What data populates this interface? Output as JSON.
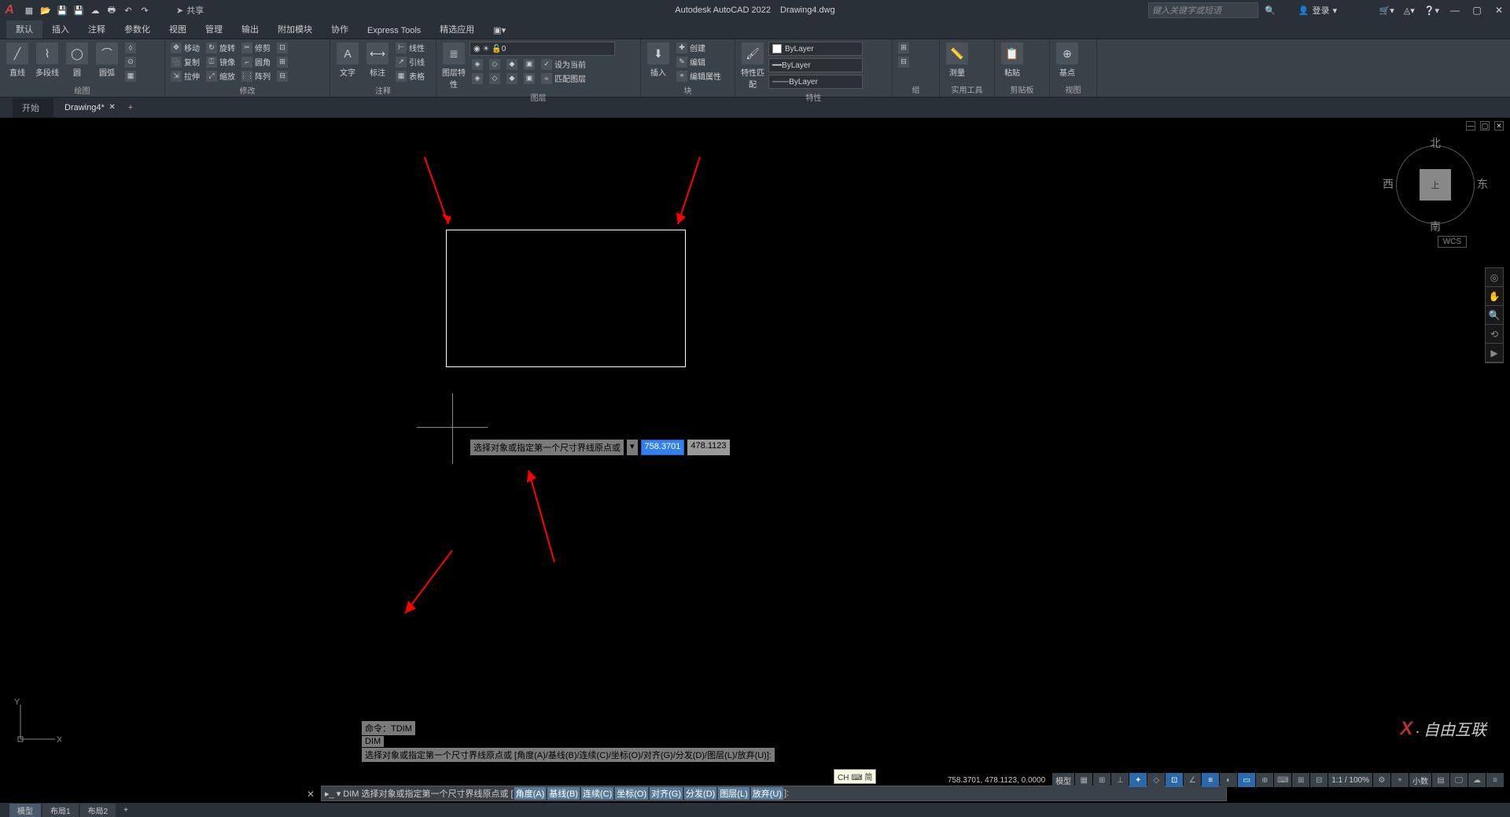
{
  "title": {
    "app": "Autodesk AutoCAD 2022",
    "file": "Drawing4.dwg"
  },
  "share": "共享",
  "search_placeholder": "键入关键字或短语",
  "login": "登录",
  "menutabs": [
    "默认",
    "插入",
    "注释",
    "参数化",
    "视图",
    "管理",
    "输出",
    "附加模块",
    "协作",
    "Express Tools",
    "精选应用"
  ],
  "ribbon": {
    "draw": {
      "title": "绘图",
      "line": "直线",
      "polyline": "多段线",
      "circle": "圆",
      "arc": "圆弧"
    },
    "modify": {
      "title": "修改",
      "move": "移动",
      "copy": "复制",
      "stretch": "拉伸",
      "rotate": "旋转",
      "mirror": "镜像",
      "scale": "缩放",
      "trim": "修剪",
      "fillet": "圆角",
      "array": "阵列"
    },
    "annot": {
      "title": "注释",
      "text": "文字",
      "dim": "标注",
      "linear": "线性",
      "leader": "引线",
      "table": "表格"
    },
    "layers": {
      "title": "图层",
      "props": "图层特性",
      "current": "设为当前",
      "match": "匹配图层",
      "value": "0"
    },
    "block": {
      "title": "块",
      "insert": "插入",
      "create": "创建",
      "edit": "编辑",
      "attr": "编辑属性"
    },
    "props": {
      "title": "特性",
      "match": "特性匹配",
      "bylayer": "ByLayer"
    },
    "group": {
      "title": "组"
    },
    "util": {
      "title": "实用工具",
      "measure": "测量"
    },
    "clip": {
      "title": "剪贴板",
      "paste": "粘贴"
    },
    "view": {
      "title": "视图",
      "base": "基点"
    }
  },
  "filetabs": {
    "start": "开始",
    "active": "Drawing4*"
  },
  "viewcube": {
    "n": "北",
    "s": "南",
    "e": "东",
    "w": "西",
    "top": "上",
    "wcs": "WCS"
  },
  "tooltip": {
    "label": "选择对象或指定第一个尺寸界线原点或",
    "x": "758.3701",
    "y": "478.1123"
  },
  "cmd_history": {
    "l1": "命令：TDIM",
    "l2": "DIM",
    "l3": "选择对象或指定第一个尺寸界线原点或 [角度(A)/基线(B)/连续(C)/坐标(O)/对齐(G)/分发(D)/图层(L)/放弃(U)]:"
  },
  "cmdline": {
    "prefix": "DIM 选择对象或指定第一个尺寸界线原点或 [",
    "opts": [
      "角度(A)",
      "基线(B)",
      "连续(C)",
      "坐标(O)",
      "对齐(G)",
      "分发(D)",
      "图层(L)",
      "放弃(U)"
    ],
    "suffix": "]:"
  },
  "layout_tabs": {
    "model": "模型",
    "l1": "布局1",
    "l2": "布局2"
  },
  "statusbar": {
    "coords": "758.3701, 478.1123, 0.0000",
    "model": "模型",
    "scale": "1:1 / 100%",
    "decimal": "小数"
  },
  "ime": "CH ⌨ 简",
  "ucs": {
    "x": "X",
    "y": "Y"
  },
  "watermark": "自由互联"
}
